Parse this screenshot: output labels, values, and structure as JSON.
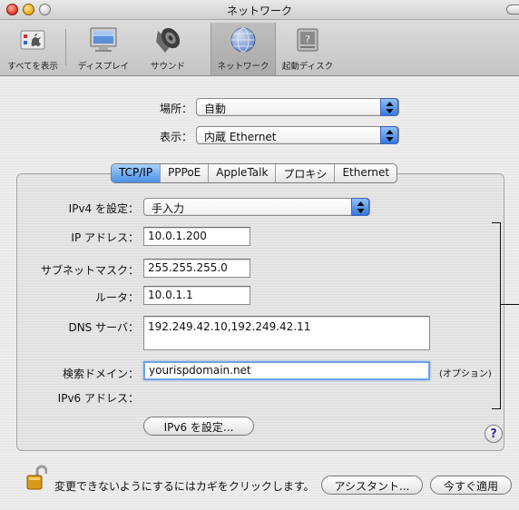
{
  "window": {
    "title": "ネットワーク"
  },
  "toolbar": {
    "items": [
      {
        "label": "すべてを表示",
        "icon": "apple-grid-icon"
      },
      {
        "label": "ディスプレイ",
        "icon": "display-icon"
      },
      {
        "label": "サウンド",
        "icon": "speaker-icon"
      },
      {
        "label": "ネットワーク",
        "icon": "network-globe-icon",
        "selected": true
      },
      {
        "label": "起動ディスク",
        "icon": "hard-disk-icon"
      }
    ]
  },
  "location": {
    "label": "場所：",
    "value": "自動"
  },
  "show": {
    "label": "表示：",
    "value": "内蔵 Ethernet"
  },
  "tabs": [
    "TCP/IP",
    "PPPoE",
    "AppleTalk",
    "プロキシ",
    "Ethernet"
  ],
  "active_tab": "TCP/IP",
  "form": {
    "configure_ipv4": {
      "label": "IPv4 を設定：",
      "value": "手入力"
    },
    "ip_address": {
      "label": "IP アドレス：",
      "value": "10.0.1.200"
    },
    "subnet_mask": {
      "label": "サブネットマスク：",
      "value": "255.255.255.0"
    },
    "router": {
      "label": "ルータ：",
      "value": "10.0.1.1"
    },
    "dns_servers": {
      "label": "DNS サーバ：",
      "value": "192.249.42.10,192.249.42.11"
    },
    "search_domains": {
      "label": "検索ドメイン：",
      "value": "yourispdomain.net"
    },
    "optional_label": "(オプション)",
    "ipv6_address": {
      "label": "IPv6 アドレス："
    },
    "configure_ipv6_button": "IPv6 を設定...",
    "help_button": "?"
  },
  "footer": {
    "lock_text": "変更できないようにするにはカギをクリックします。",
    "assistant_button": "アシスタント...",
    "apply_button": "今すぐ適用"
  },
  "colors": {
    "accent": "#3479e0",
    "tab_active": "#4a8ee8",
    "focus_ring": "#6ea3e8"
  }
}
